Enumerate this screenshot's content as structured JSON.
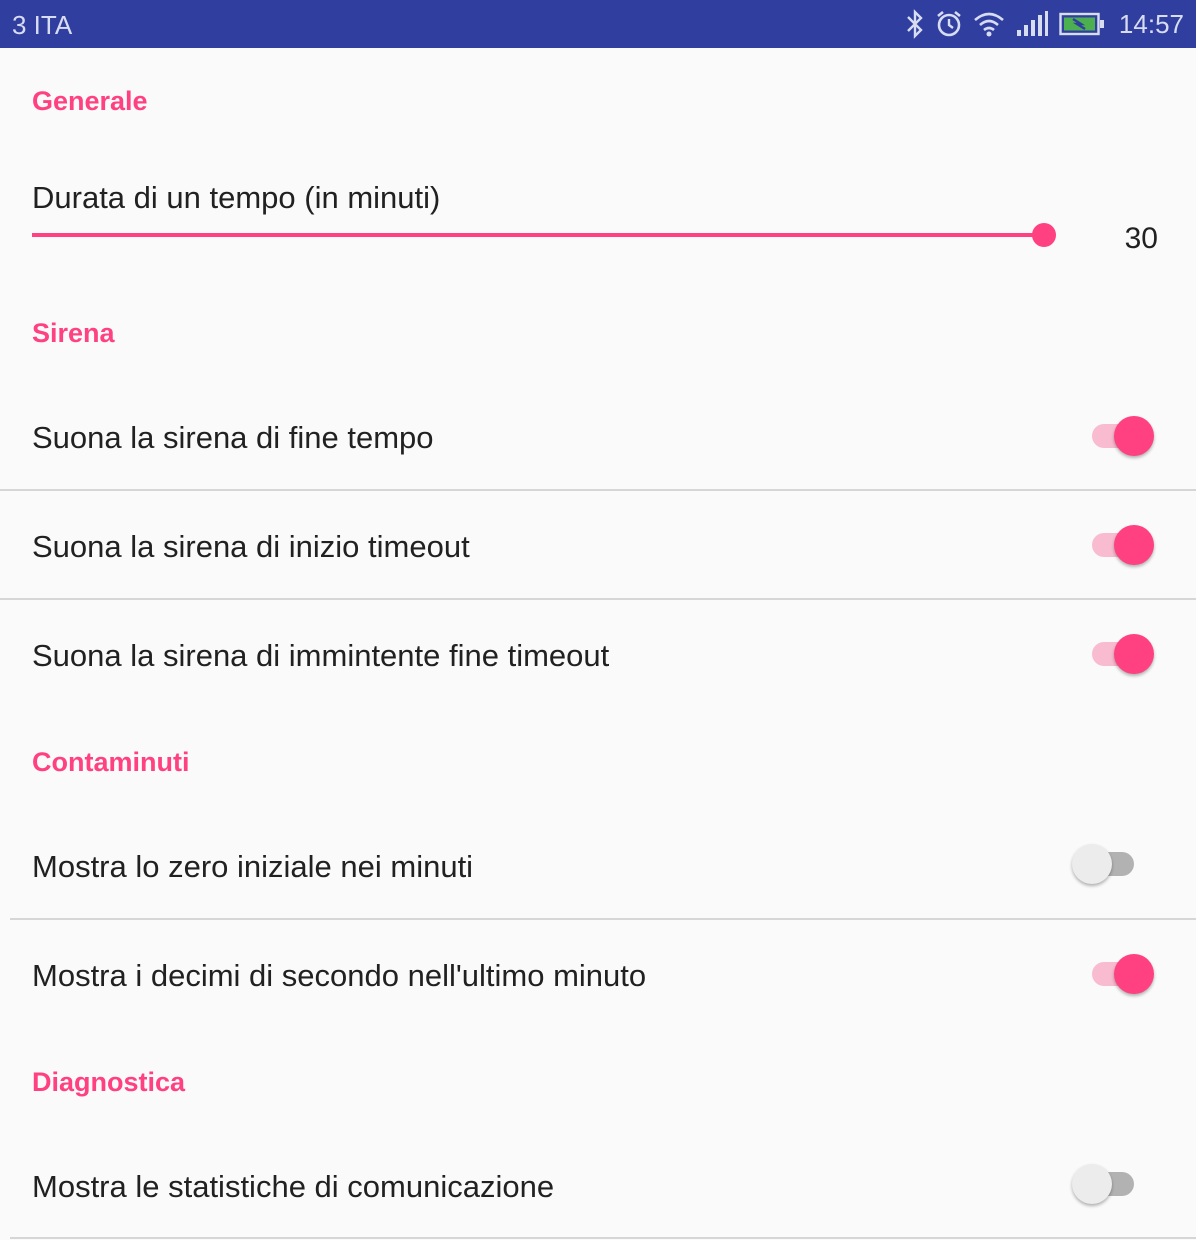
{
  "status_bar": {
    "carrier": "3 ITA",
    "time": "14:57",
    "icons": [
      "bluetooth-icon",
      "alarm-icon",
      "wifi-icon",
      "signal-icon",
      "battery-charging-icon"
    ]
  },
  "colors": {
    "accent": "#ff4081",
    "status_bar": "#303f9f"
  },
  "sections": {
    "generale": {
      "header": "Generale",
      "duration_title": "Durata di un tempo (in minuti)",
      "duration_value": "30",
      "duration_fill_fraction": 1.0
    },
    "sirena": {
      "header": "Sirena",
      "items": [
        {
          "label": "Suona la sirena di fine tempo",
          "on": true
        },
        {
          "label": "Suona la sirena di inizio timeout",
          "on": true
        },
        {
          "label": "Suona la sirena di immintente fine timeout",
          "on": true
        }
      ]
    },
    "contaminuti": {
      "header": "Contaminuti",
      "items": [
        {
          "label": "Mostra lo zero iniziale nei minuti",
          "on": false
        },
        {
          "label": "Mostra i decimi di secondo nell'ultimo minuto",
          "on": true
        }
      ]
    },
    "diagnostica": {
      "header": "Diagnostica",
      "items": [
        {
          "label": "Mostra le statistiche di comunicazione",
          "on": false
        }
      ]
    }
  }
}
